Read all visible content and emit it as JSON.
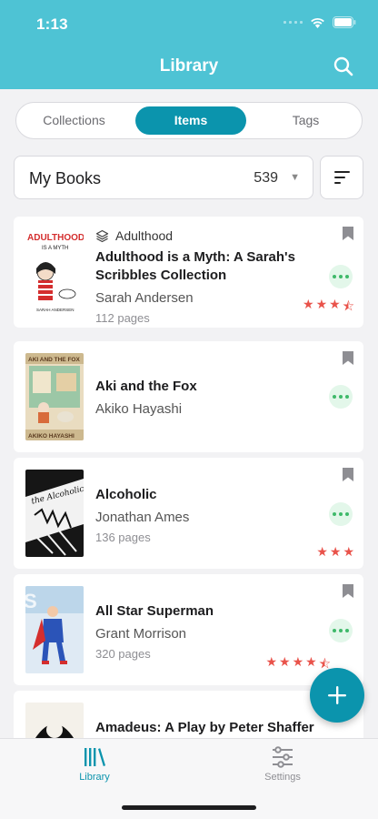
{
  "status_bar": {
    "time": "1:13"
  },
  "header": {
    "title": "Library",
    "search_icon": "search-icon"
  },
  "segments": [
    {
      "label": "Collections",
      "active": false
    },
    {
      "label": "Items",
      "active": true
    },
    {
      "label": "Tags",
      "active": false
    }
  ],
  "shelf": {
    "name": "My Books",
    "count": "539",
    "caret_icon": "caret-down-icon"
  },
  "sort": {
    "icon": "sort-icon"
  },
  "books": [
    {
      "collection": "Adulthood",
      "title": "Adulthood is a Myth: A Sarah's Scribbles Collection",
      "author": "Sarah Andersen",
      "pages": "112 pages",
      "rating": 3.5,
      "cover_text": "ADULTHOOD IS A MYTH",
      "cover_sub": "SARAH ANDERSEN"
    },
    {
      "collection": "",
      "title": "Aki and the Fox",
      "author": "Akiko Hayashi",
      "pages": "",
      "rating": 0,
      "cover_text": "AKI AND THE FOX",
      "cover_sub": "AKIKO HAYASHI"
    },
    {
      "collection": "",
      "title": "Alcoholic",
      "author": "Jonathan Ames",
      "pages": "136 pages",
      "rating": 3,
      "cover_text": "the Alcoholic",
      "cover_sub": ""
    },
    {
      "collection": "",
      "title": "All Star Superman",
      "author": "Grant Morrison",
      "pages": "320 pages",
      "rating": 4.5,
      "cover_text": "",
      "cover_sub": ""
    },
    {
      "collection": "",
      "title": "Amadeus: A Play by Peter Shaffer",
      "author": "",
      "pages": "",
      "rating": 0,
      "cover_text": "",
      "cover_sub": ""
    }
  ],
  "fab": {
    "icon": "plus-icon"
  },
  "tabs": [
    {
      "label": "Library",
      "icon": "library-icon",
      "active": true
    },
    {
      "label": "Settings",
      "icon": "sliders-icon",
      "active": false
    }
  ],
  "colors": {
    "header": "#4ec3d4",
    "accent": "#0b94ad",
    "star": "#e9534b",
    "more": "#3fb96a"
  }
}
